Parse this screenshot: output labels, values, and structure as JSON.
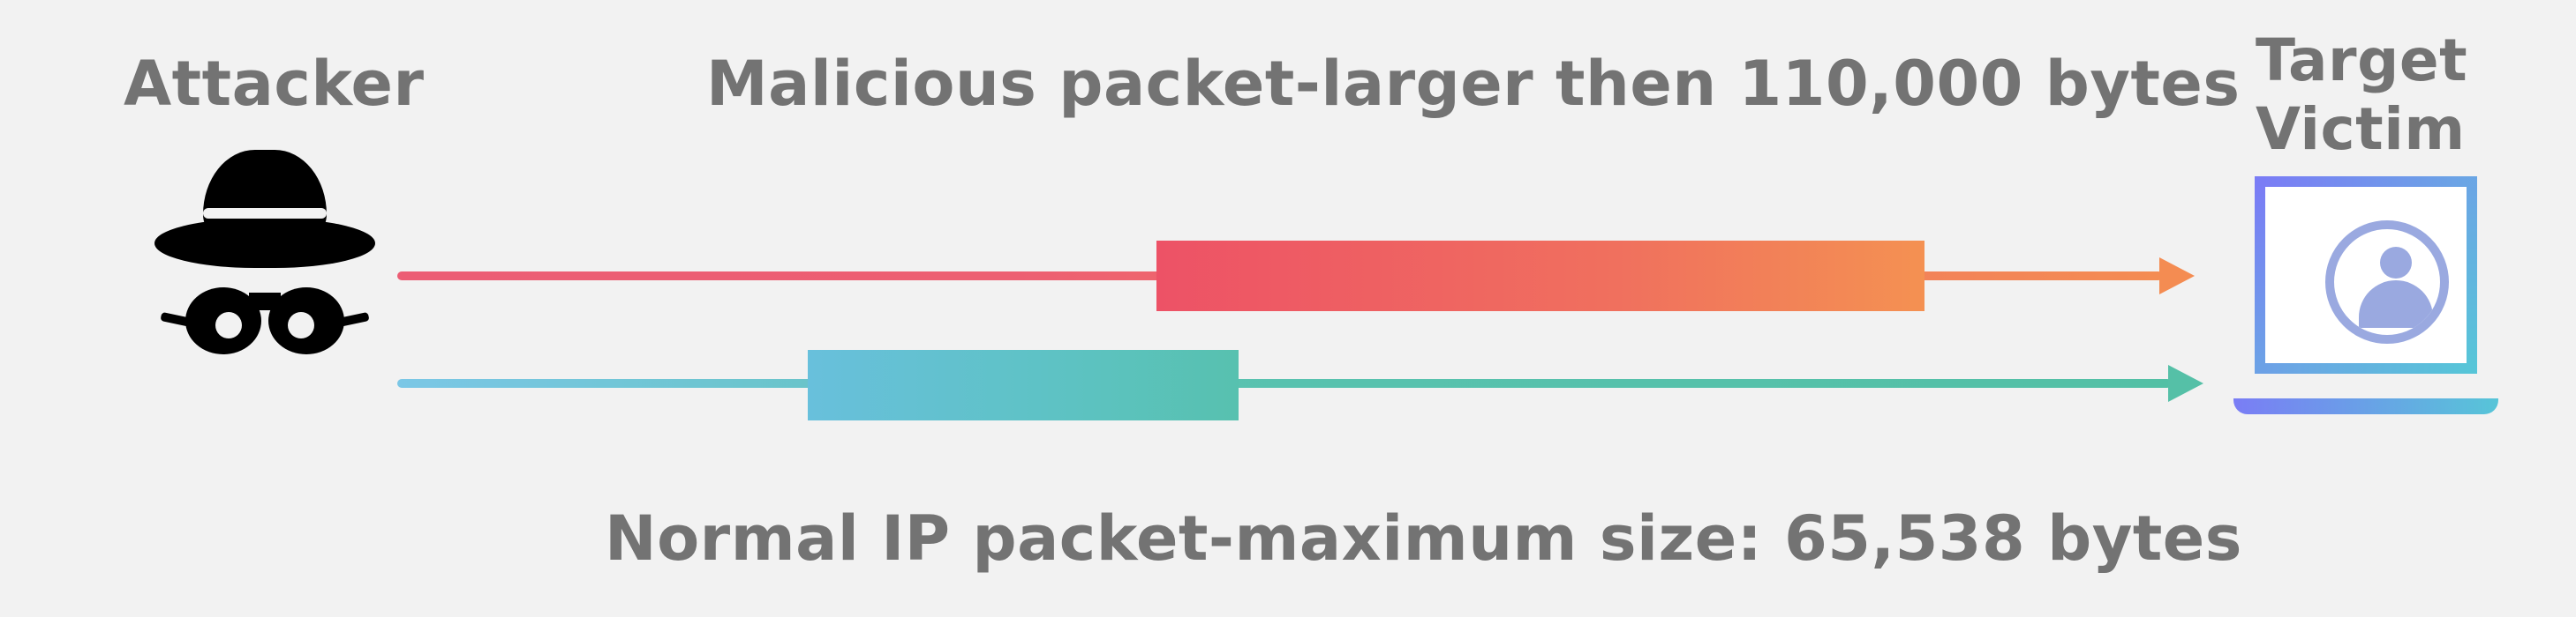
{
  "labels": {
    "attacker": "Attacker",
    "malicious": "Malicious packet-larger then 110,000 bytes",
    "normal": "Normal IP packet-maximum size: 65,538 bytes",
    "target_line1": "Target",
    "target_line2": "Victim"
  },
  "packets": {
    "malicious_bytes_min": 110000,
    "normal_bytes_max": 65538
  },
  "icons": {
    "attacker": "hacker-hat-mask-icon",
    "target": "laptop-user-icon"
  },
  "colors": {
    "malicious_gradient": [
      "#ed5266",
      "#f49152"
    ],
    "normal_gradient": [
      "#68c0dc",
      "#55c0a7"
    ],
    "laptop_gradient": [
      "#7a7df5",
      "#57c5d8"
    ],
    "text": "#737373",
    "bg": "#f2f2f2"
  }
}
